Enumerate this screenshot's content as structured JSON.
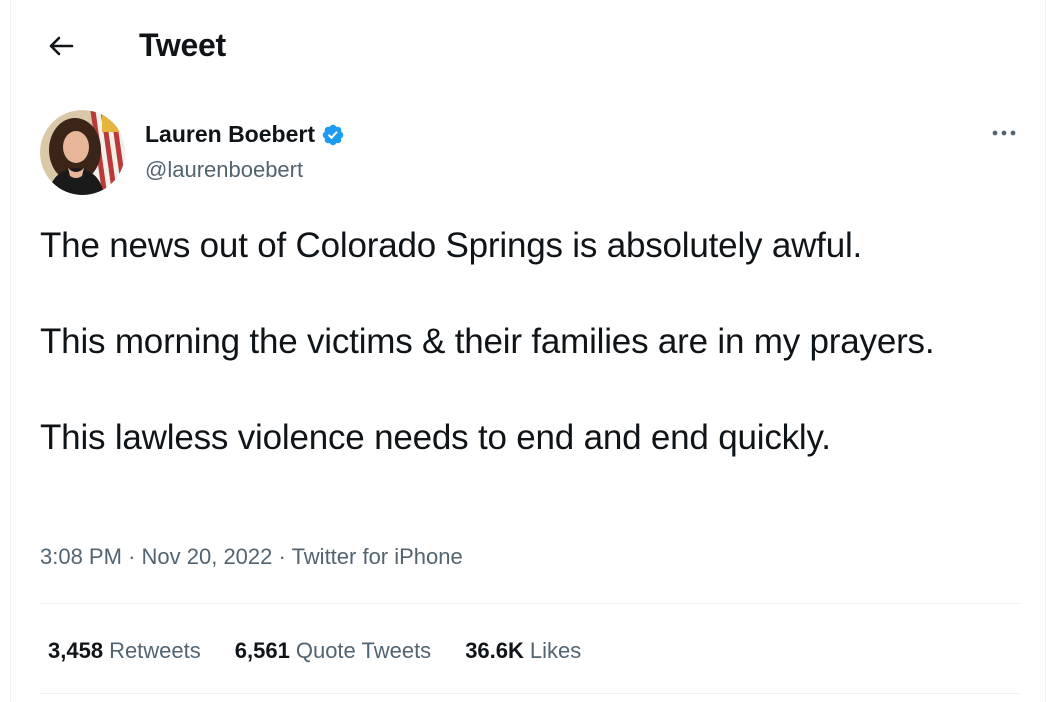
{
  "header": {
    "title": "Tweet",
    "back_icon": "arrow-left-icon"
  },
  "author": {
    "name": "Lauren Boebert",
    "handle": "@laurenboebert",
    "verified_icon": "verified-badge-icon",
    "verified_color": "#1d9bf0"
  },
  "tweet": {
    "paragraphs": [
      "The news out of Colorado Springs is absolutely awful.",
      "This morning the victims & their families are in my prayers.",
      "This lawless violence needs to end and end quickly."
    ],
    "time": "3:08 PM",
    "separator": "·",
    "date": "Nov 20, 2022",
    "source": "Twitter for iPhone"
  },
  "stats": {
    "retweets_count": "3,458",
    "retweets_label": "Retweets",
    "quotes_count": "6,561",
    "quotes_label": "Quote Tweets",
    "likes_count": "36.6K",
    "likes_label": "Likes"
  },
  "colors": {
    "text": "#0f1419",
    "secondary": "#536471",
    "divider": "#eff3f4",
    "accent": "#1d9bf0"
  }
}
